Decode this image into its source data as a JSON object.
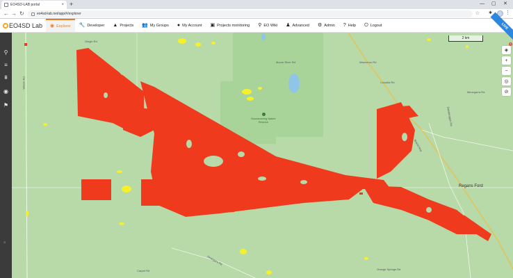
{
  "browser": {
    "tab_title": "EO4SD-LAB portal",
    "close_glyph": "×",
    "new_tab_glyph": "+",
    "url": "eo4sd-lab.net/app/#/explorer",
    "back_glyph": "←",
    "forward_glyph": "→",
    "reload_glyph": "↻",
    "star_glyph": "☆",
    "ext_glyph": "✱",
    "menu_glyph": "⋮",
    "minimize_glyph": "—",
    "maximize_glyph": "▢",
    "window_close_glyph": "✕"
  },
  "app": {
    "logo_text": "EO4SD Lab",
    "beta_label": "LIVE",
    "nav": [
      {
        "label": "Explorer",
        "icon": "globe-icon",
        "glyph": "◉",
        "active": true
      },
      {
        "label": "Developer",
        "icon": "wrench-icon",
        "glyph": "🔧",
        "active": false
      },
      {
        "label": "Projects",
        "icon": "warning-triangle-icon",
        "glyph": "▲",
        "active": false
      },
      {
        "label": "My Groups",
        "icon": "users-icon",
        "glyph": "👥",
        "active": false
      },
      {
        "label": "My Account",
        "icon": "account-icon",
        "glyph": "●",
        "active": false
      },
      {
        "label": "Projects monitoring",
        "icon": "monitor-icon",
        "glyph": "▣",
        "active": false
      },
      {
        "label": "EO Wiki",
        "icon": "pin-icon",
        "glyph": "⚲",
        "active": false
      },
      {
        "label": "Advanced",
        "icon": "person-icon",
        "glyph": "♟",
        "active": false
      },
      {
        "label": "Admin",
        "icon": "gear-icon",
        "glyph": "⚙",
        "active": false
      },
      {
        "label": "Help",
        "icon": "help-icon",
        "glyph": "?",
        "active": false
      },
      {
        "label": "Logout",
        "icon": "power-icon",
        "glyph": "⏻",
        "active": false
      }
    ]
  },
  "sidebar": {
    "tools": [
      {
        "name": "search-icon",
        "glyph": "⚲"
      },
      {
        "name": "layers-icon",
        "glyph": "≡"
      },
      {
        "name": "data-icon",
        "glyph": "⩩"
      },
      {
        "name": "eye-icon",
        "glyph": "◉"
      },
      {
        "name": "flag-icon",
        "glyph": "⚑"
      }
    ]
  },
  "map": {
    "scale_label": "2 km",
    "controls": [
      {
        "name": "basemap-icon",
        "glyph": "◈"
      },
      {
        "name": "zoom-in-icon",
        "glyph": "+"
      },
      {
        "name": "zoom-out-icon",
        "glyph": "−"
      },
      {
        "name": "globe-icon",
        "glyph": "◎"
      },
      {
        "name": "hide-icon",
        "glyph": "⊘"
      }
    ],
    "badge_count": "2",
    "town_label": "Regans Ford",
    "reserve_label": "Boonanarring Nature Reserve",
    "road_labels": [
      "Gingin Rd",
      "Wanneroo Rd",
      "Dandaragan Rd",
      "Brand Hwy",
      "Cowalla Rd",
      "Moore River Rd",
      "Carpet Rd",
      "Orange Springs Rd",
      "Gnangara Rd",
      "Mimegarra Rd",
      "Wilson Rd"
    ],
    "route_shields": [
      "1",
      "5",
      "95"
    ],
    "google_mark": "G"
  }
}
